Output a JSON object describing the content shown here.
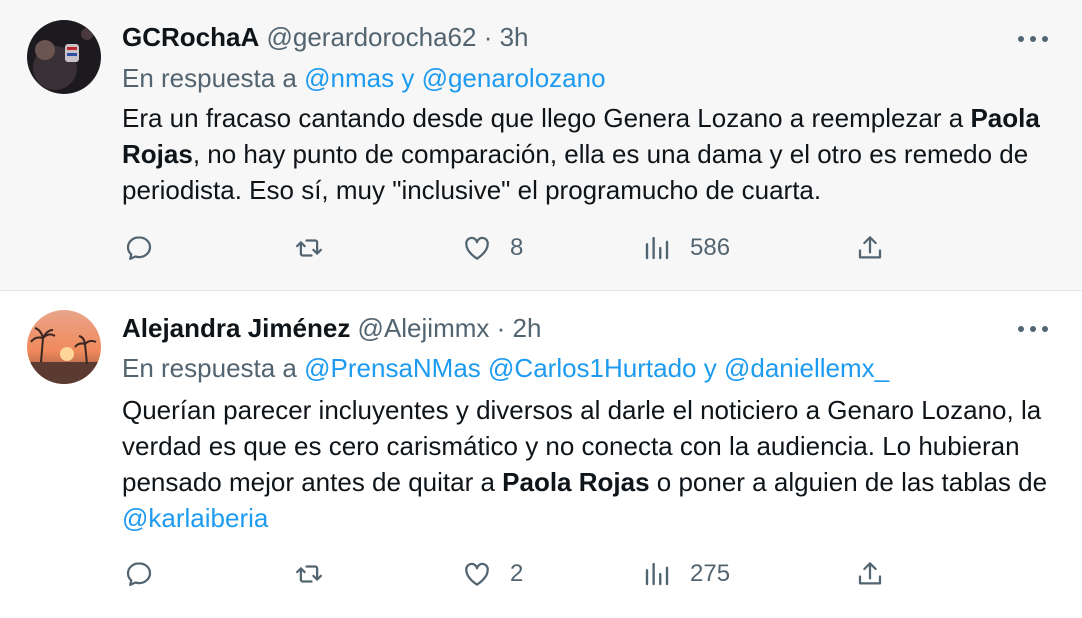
{
  "tweets": [
    {
      "display_name": "GCRochaA",
      "handle": "@gerardorocha62",
      "dot": "·",
      "time": "3h",
      "reply_prefix": "En respuesta a ",
      "reply_mentions": [
        "@nmas",
        " y ",
        "@genarolozano"
      ],
      "body": {
        "p1": "Era un fracaso cantando desde que llego Genera Lozano a reemplezar a ",
        "bold1": "Paola Rojas",
        "p2": ", no hay punto de comparación, ella es una dama y el otro es remedo de periodista. Eso sí, muy \"inclusive\" el programucho de cuarta."
      },
      "actions": {
        "reply": "",
        "retweet": "",
        "likes": "8",
        "views": "586"
      }
    },
    {
      "display_name": "Alejandra Jiménez",
      "handle": "@Alejimmx",
      "dot": "·",
      "time": "2h",
      "reply_prefix": "En respuesta a ",
      "reply_mentions": [
        "@PrensaNMas",
        " ",
        "@Carlos1Hurtado",
        " y ",
        "@daniellemx_"
      ],
      "body": {
        "p1": "Querían parecer incluyentes y diversos al darle el noticiero a Genaro Lozano, la verdad es que es cero carismático y no conecta con la audiencia. Lo hubieran pensado mejor antes de quitar a ",
        "bold1": "Paola Rojas",
        "p2": " o poner a alguien de las tablas de ",
        "mention1": "@karlaiberia"
      },
      "actions": {
        "reply": "",
        "retweet": "",
        "likes": "2",
        "views": "275"
      }
    }
  ],
  "icons": {
    "reply": "reply-icon",
    "retweet": "retweet-icon",
    "like": "heart-icon",
    "views": "views-icon",
    "share": "share-icon",
    "more": "more-icon"
  },
  "colors": {
    "text": "#0f1419",
    "secondary": "#536471",
    "link": "#1d9bf0",
    "highlight_bg": "#f7f7f7"
  }
}
